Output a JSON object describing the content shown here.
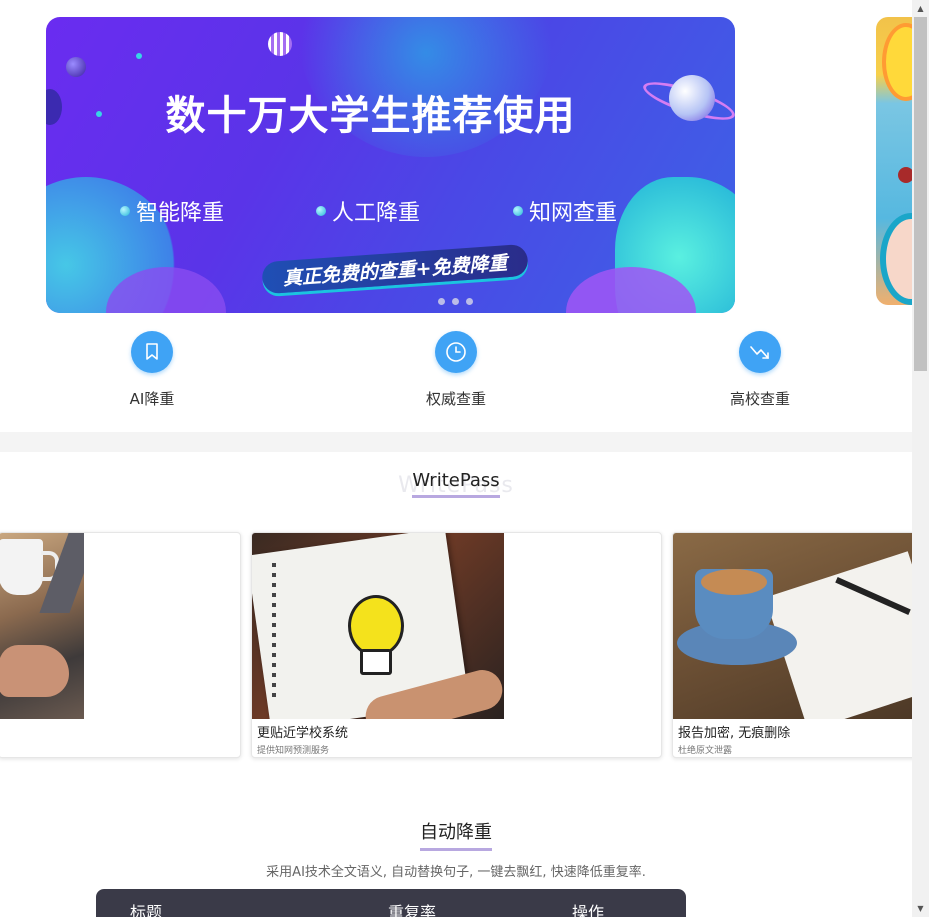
{
  "banner": {
    "title": "数十万大学生推荐使用",
    "features": [
      "智能降重",
      "人工降重",
      "知网查重"
    ],
    "pill": "真正免费的查重+免费降重",
    "slide_count": 3
  },
  "quick_nav": [
    {
      "label": "AI降重",
      "icon": "bookmark-icon"
    },
    {
      "label": "权威查重",
      "icon": "clock-icon"
    },
    {
      "label": "高校查重",
      "icon": "trend-down-icon"
    }
  ],
  "section1": {
    "title": "WritePass",
    "ghost": "WritePass"
  },
  "cards": [
    {
      "title": "",
      "subtitle": "",
      "image": "coffee-laptop-photo"
    },
    {
      "title": "更贴近学校系统",
      "subtitle": "提供知网预测服务",
      "image": "lightbulb-notebook-photo"
    },
    {
      "title": "报告加密, 无痕删除",
      "subtitle": "杜绝原文泄露",
      "image": "coffee-notebook-photo"
    }
  ],
  "section2": {
    "title": "自动降重",
    "subtitle": "采用AI技术全文语义, 自动替换句子, 一键去飘红, 快速降低重复率."
  },
  "table": {
    "headers": [
      "标题",
      "重复率",
      "操作"
    ]
  },
  "colors": {
    "accent_blue": "#3fa3f5",
    "underline": "#b8a8e0",
    "table_head": "#3a3a48"
  }
}
